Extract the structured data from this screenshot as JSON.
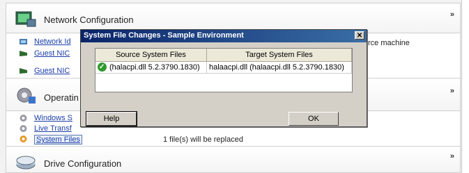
{
  "sections": {
    "network": {
      "title": "Network Configuration",
      "collapse": "»",
      "items": [
        "Network Id",
        "Guest NIC",
        "Guest NIC"
      ],
      "trailing_text": "rce machine"
    },
    "operating": {
      "title": "Operatin",
      "collapse": "»",
      "items": [
        "Windows S",
        "Live Transf",
        "System Files"
      ],
      "status": "1 file(s) will be replaced"
    },
    "drive": {
      "title": "Drive Configuration",
      "collapse": "»"
    }
  },
  "dialog": {
    "title": "System File Changes - Sample Environment",
    "close": "✕",
    "columns": [
      "Source System Files",
      "Target System Files"
    ],
    "rows": [
      {
        "source": "(halacpi.dll 5.2.3790.1830)",
        "target": "halaacpi.dll (halaacpi.dll 5.2.3790.1830)",
        "status_icon": "check-icon"
      }
    ],
    "help_label": "Help",
    "ok_label": "OK"
  },
  "colors": {
    "link": "#1a3ea8",
    "title_bar": "#0a246a"
  }
}
